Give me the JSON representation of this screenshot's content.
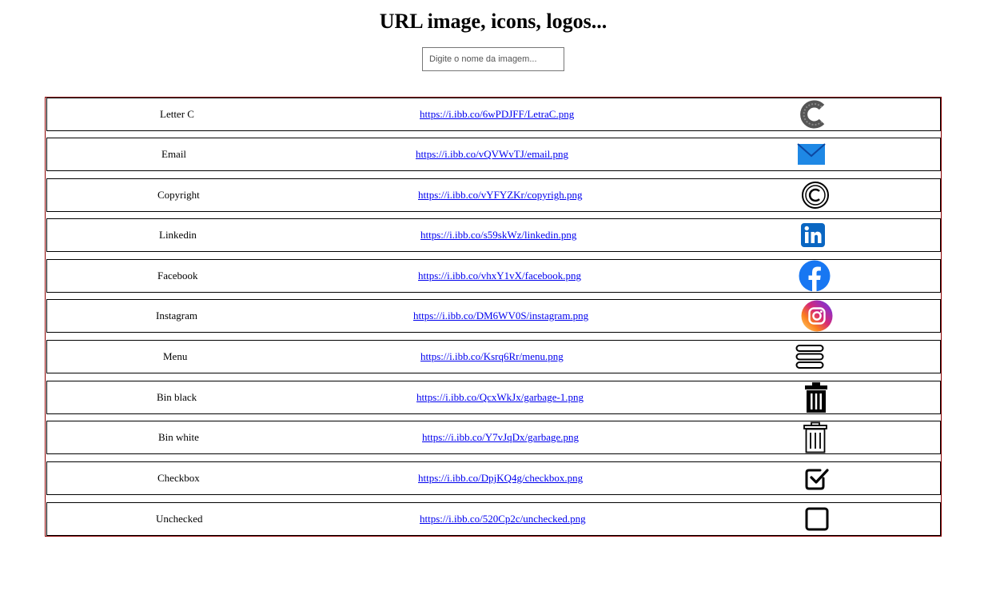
{
  "page": {
    "title": "URL image, icons, logos...",
    "search_placeholder": "Digite o nome da imagem..."
  },
  "rows": [
    {
      "name": "Letter C",
      "url": "https://i.ibb.co/6wPDJFF/LetraC.png",
      "icon": "letter-c-icon"
    },
    {
      "name": "Email",
      "url": "https://i.ibb.co/vQVWvTJ/email.png",
      "icon": "email-icon"
    },
    {
      "name": "Copyright",
      "url": "https://i.ibb.co/vYFYZKr/copyrigh.png",
      "icon": "copyright-icon"
    },
    {
      "name": "Linkedin",
      "url": "https://i.ibb.co/s59skWz/linkedin.png",
      "icon": "linkedin-icon"
    },
    {
      "name": "Facebook",
      "url": "https://i.ibb.co/vhxY1vX/facebook.png",
      "icon": "facebook-icon"
    },
    {
      "name": "Instagram",
      "url": "https://i.ibb.co/DM6WV0S/instagram.png",
      "icon": "instagram-icon"
    },
    {
      "name": "Menu",
      "url": "https://i.ibb.co/Ksrq6Rr/menu.png",
      "icon": "menu-icon"
    },
    {
      "name": "Bin black",
      "url": "https://i.ibb.co/QcxWkJx/garbage-1.png",
      "icon": "bin-black-icon"
    },
    {
      "name": "Bin white",
      "url": "https://i.ibb.co/Y7vJqDx/garbage.png",
      "icon": "bin-white-icon"
    },
    {
      "name": "Checkbox",
      "url": "https://i.ibb.co/DpjKQ4g/checkbox.png",
      "icon": "checkbox-icon"
    },
    {
      "name": "Unchecked",
      "url": "https://i.ibb.co/520Cp2c/unchecked.png",
      "icon": "unchecked-icon"
    }
  ],
  "colors": {
    "table_border": "#8b0000",
    "link": "#0000ee",
    "email_blue": "#1e88e5",
    "linkedin_blue": "#0a66c2",
    "facebook_blue": "#1877f2"
  }
}
